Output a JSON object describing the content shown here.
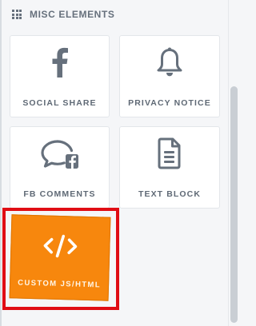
{
  "section": {
    "title": "MISC ELEMENTS",
    "icon": "grid-icon"
  },
  "elements": [
    {
      "label": "SOCIAL SHARE",
      "icon": "facebook-icon"
    },
    {
      "label": "PRIVACY NOTICE",
      "icon": "bell-icon"
    },
    {
      "label": "FB COMMENTS",
      "icon": "comment-facebook-icon"
    },
    {
      "label": "TEXT BLOCK",
      "icon": "document-icon"
    },
    {
      "label": "CUSTOM JS/HTML",
      "icon": "code-icon",
      "selected": true
    }
  ],
  "colors": {
    "accent": "#f7870d",
    "highlight": "#e00d14",
    "text": "#5f6975"
  }
}
